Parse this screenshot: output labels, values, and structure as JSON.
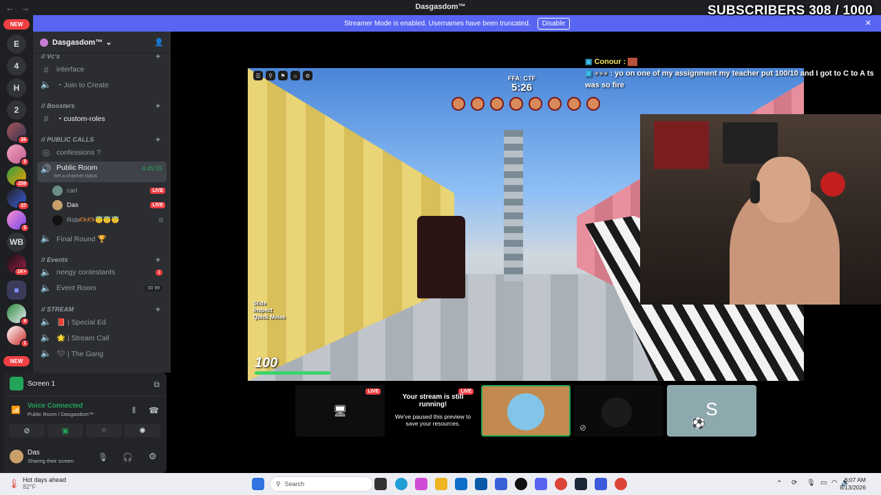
{
  "window": {
    "title": "Dasgasdom™",
    "back": "←",
    "forward": "→"
  },
  "overlay": {
    "subscribers": "SUBSCRIBERS 308 / 1000"
  },
  "banner": {
    "text": "Streamer Mode is enabled. Usernames have been truncated.",
    "button": "Disable",
    "close": "✕"
  },
  "guilds": [
    {
      "label": "NEW",
      "type": "pill"
    },
    {
      "label": "E"
    },
    {
      "label": "4"
    },
    {
      "label": "H"
    },
    {
      "label": "2"
    },
    {
      "badge": "26"
    },
    {
      "badge": "3"
    },
    {
      "badge": "259"
    },
    {
      "badge": "37"
    },
    {
      "badge": "5"
    },
    {
      "label": "WB"
    },
    {
      "badge": "1K+"
    },
    {
      "label": "folder"
    },
    {
      "badge": "4"
    },
    {
      "badge": "1"
    },
    {
      "label": "NEW",
      "type": "pill"
    }
  ],
  "server": {
    "name": "Dasgasdom™",
    "chevron": "⌄"
  },
  "sidebar": {
    "cat_vcs": "// Vc's",
    "ch_interface": "interface",
    "ch_join_create": "・Join to Create",
    "cat_boosters": "// Boosters",
    "ch_custom_roles": "・custom-roles",
    "cat_public_calls": "// PUBLIC CALLS",
    "ch_confessions": "confessions ?",
    "ch_public_room": "Public Room",
    "ch_public_room_time": "4:45:55",
    "ch_public_room_status": "Set a channel status",
    "users": [
      {
        "name": "carl",
        "live": "LIVE"
      },
      {
        "name": "Das",
        "live": "LIVE"
      },
      {
        "name": "Rob🫶🏾🫶🏾😇😇😇",
        "live": ""
      }
    ],
    "ch_final_round": "Final Round 🏆",
    "cat_events": "// Events",
    "ch_neegy": "neegy contestants",
    "ch_neegy_count": "1",
    "ch_event_room": "Event Room",
    "ch_event_room_pill": "00 99",
    "cat_stream": "// STREAM",
    "ch_special_ed": "📕 | Special Ed",
    "ch_stream_call": "🌟 | Stream Call",
    "ch_the_gang": "🖤 | The Gang"
  },
  "panel": {
    "screen_label": "Screen 1",
    "voice_connected": "Voice Connected",
    "voice_location": "Public Room / Dasgasdom™",
    "username": "Das",
    "user_status": "Sharing their screen"
  },
  "chat": {
    "line1_name": "Conour :",
    "line2": ": yo on one of my assignment my teacher put 100/10 and I got to C to A ts was so fire"
  },
  "game": {
    "mode": "FFA: CTF",
    "timer": "5:26",
    "keys": [
      "Slide",
      "Inspect",
      "Quick Melee"
    ],
    "health": "100"
  },
  "tiles": {
    "live": "LIVE",
    "paused_title": "Your stream is still running!",
    "paused_body": "We've paused this preview to save your resources.",
    "s_label": "S"
  },
  "taskbar": {
    "weather_title": "Hot days ahead",
    "weather_temp": "82°F",
    "search": "Search",
    "time": "6:07 AM",
    "date": "8/13/2026"
  }
}
